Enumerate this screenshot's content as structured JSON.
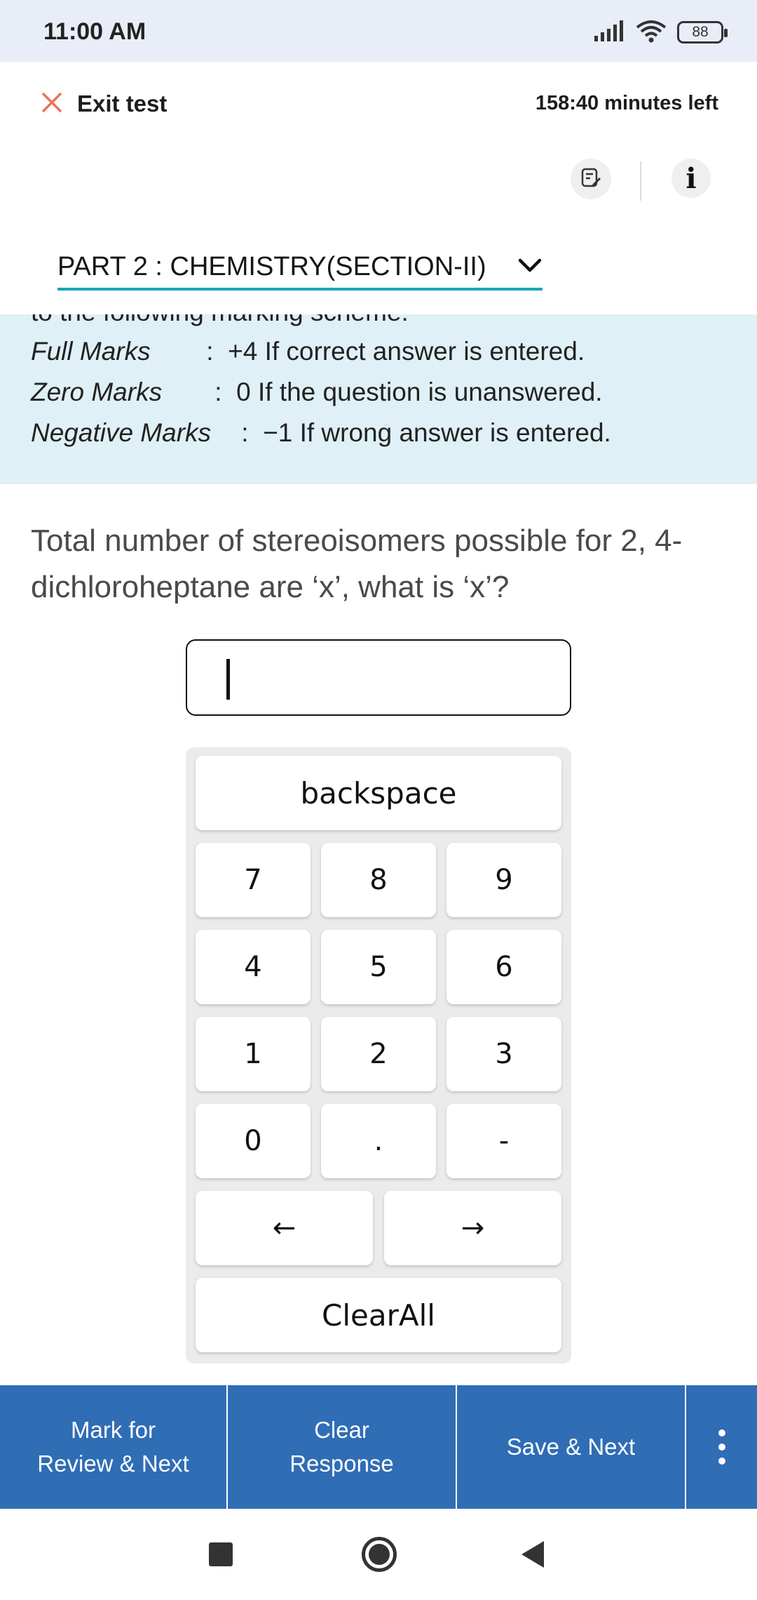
{
  "status_bar": {
    "time": "11:00 AM",
    "battery": "88",
    "icons": [
      "signal-icon",
      "wifi-icon",
      "battery-icon"
    ]
  },
  "header": {
    "exit_label": "Exit test",
    "timer": "158:40 minutes left",
    "section": "PART 2 : CHEMISTRY(SECTION-II)"
  },
  "instructions": {
    "cut_line": "to the following marking scheme:",
    "rows": [
      {
        "label": "Full Marks",
        "sep": ":",
        "text": "+4 If correct answer is entered."
      },
      {
        "label": "Zero Marks",
        "sep": ":",
        "text": "0 If the question is unanswered."
      },
      {
        "label": "Negative Marks",
        "sep": ":",
        "text": "−1 If wrong answer is entered."
      }
    ]
  },
  "question": {
    "text": "Total number of stereoisomers possible for 2, 4-dichloroheptane are ‘x’, what is ‘x’?"
  },
  "answer": {
    "value": ""
  },
  "keypad": {
    "backspace": "backspace",
    "keys": [
      "7",
      "8",
      "9",
      "4",
      "5",
      "6",
      "1",
      "2",
      "3",
      "0",
      ".",
      "-"
    ],
    "left": "←",
    "right": "→",
    "clear_all": "ClearAll"
  },
  "actions": {
    "mark_review_line1": "Mark for",
    "mark_review_line2": "Review & Next",
    "clear_line1": "Clear",
    "clear_line2": "Response",
    "save_next": "Save & Next"
  },
  "colors": {
    "status_bg": "#e8edf8",
    "accent_underline": "#1aa4b6",
    "instructions_bg": "#dff0f6",
    "action_bar_bg": "#2f6db5",
    "exit_icon": "#e8735a"
  }
}
